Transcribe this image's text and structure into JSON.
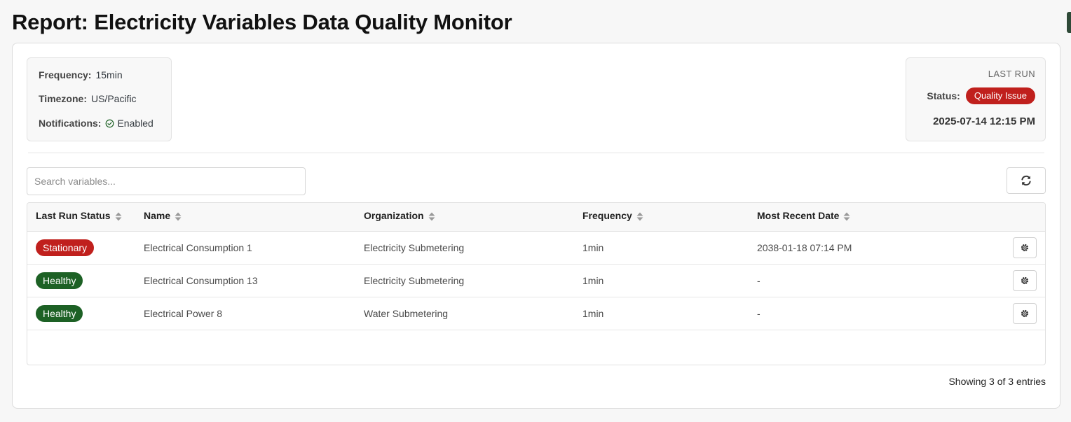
{
  "page": {
    "title": "Report: Electricity Variables Data Quality Monitor"
  },
  "info": {
    "frequency_label": "Frequency:",
    "frequency_value": "15min",
    "timezone_label": "Timezone:",
    "timezone_value": "US/Pacific",
    "notifications_label": "Notifications:",
    "notifications_value": "Enabled",
    "notifications_icon": "check-circle-icon"
  },
  "last_run": {
    "heading": "LAST RUN",
    "status_label": "Status:",
    "status_value": "Quality Issue",
    "status_color": "#c0201d",
    "timestamp": "2025-07-14 12:15 PM"
  },
  "search": {
    "placeholder": "Search variables...",
    "value": ""
  },
  "toolbar": {
    "refresh_icon": "refresh-icon"
  },
  "table": {
    "columns": [
      "Last Run Status",
      "Name",
      "Organization",
      "Frequency",
      "Most Recent Date"
    ],
    "rows": [
      {
        "status": "Stationary",
        "status_color": "#c0201d",
        "name": "Electrical Consumption 1",
        "organization": "Electricity Submetering",
        "frequency": "1min",
        "most_recent_date": "2038-01-18 07:14 PM"
      },
      {
        "status": "Healthy",
        "status_color": "#1d6125",
        "name": "Electrical Consumption 13",
        "organization": "Electricity Submetering",
        "frequency": "1min",
        "most_recent_date": "-"
      },
      {
        "status": "Healthy",
        "status_color": "#1d6125",
        "name": "Electrical Power 8",
        "organization": "Water Submetering",
        "frequency": "1min",
        "most_recent_date": "-"
      }
    ]
  },
  "footer": {
    "entries_text": "Showing 3 of 3 entries"
  }
}
